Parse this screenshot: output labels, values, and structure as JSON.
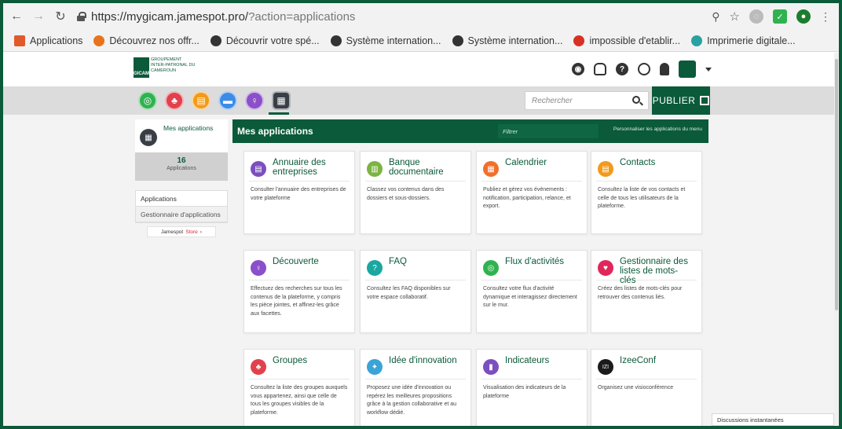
{
  "browser": {
    "url_host": "https://mygicam.jamespot.pro/",
    "url_path": "?action=applications",
    "bookmarks": [
      {
        "label": "Applications",
        "color": "#e0592a"
      },
      {
        "label": "Découvrez nos offr...",
        "color": "#e8731b"
      },
      {
        "label": "Découvrir votre spé...",
        "color": "#333333"
      },
      {
        "label": "Système internation...",
        "color": "#333333"
      },
      {
        "label": "Système internation...",
        "color": "#333333"
      },
      {
        "label": "impossible d'etablir...",
        "color": "#d93025"
      },
      {
        "label": "Imprimerie digitale...",
        "color": "#2aa1a1"
      }
    ]
  },
  "header": {
    "logo_text": "GROUPEMENT INTER-PATRONAL DU CAMEROUN",
    "logo_abbr": "GICAM",
    "icons": [
      "globe-icon",
      "bell-icon",
      "help-icon",
      "clock-icon",
      "user-icon"
    ]
  },
  "toolbar": {
    "app_dots": [
      {
        "name": "activity-app-icon",
        "color": "#2fb24f"
      },
      {
        "name": "groups-app-icon",
        "color": "#e2414c"
      },
      {
        "name": "directory-app-icon",
        "color": "#f29a1a"
      },
      {
        "name": "chat-app-icon",
        "color": "#3d8be8"
      },
      {
        "name": "discover-app-icon",
        "color": "#8a4fc9"
      },
      {
        "name": "apps-grid-icon",
        "color": "#3a3f47"
      }
    ],
    "search_placeholder": "Rechercher",
    "publish_label": "PUBLIER"
  },
  "left_panel": {
    "title": "Mes applications",
    "count": "16",
    "count_label": "Applications",
    "menu": [
      "Applications",
      "Gestionnaire d'applications"
    ],
    "store_label": "Jamespot",
    "store_highlight": "Store"
  },
  "content": {
    "title": "Mes applications",
    "filter_placeholder": "Filtrer",
    "customize_label": "Personnaliser les applications du menu",
    "cards": [
      {
        "title": "Annuaire des entreprises",
        "desc": "Consulter l'annuaire des entreprises de votre plateforme",
        "color": "#7c4fbf",
        "icon": "directory-icon",
        "glyph": "▤"
      },
      {
        "title": "Banque documentaire",
        "desc": "Classez vos contenus dans des dossiers et sous-dossiers.",
        "color": "#7cb342",
        "icon": "documents-icon",
        "glyph": "▥"
      },
      {
        "title": "Calendrier",
        "desc": "Publiez et gérez vos événements : notification, participation, relance, et export.",
        "color": "#f26f2a",
        "icon": "calendar-icon",
        "glyph": "▦"
      },
      {
        "title": "Contacts",
        "desc": "Consultez la liste de vos contacts et celle de tous les utilisateurs de la plateforme.",
        "color": "#f29a1a",
        "icon": "contacts-icon",
        "glyph": "▤"
      },
      {
        "title": "Découverte",
        "desc": "Effectuez des recherches sur tous les contenus de la plateforme, y compris les pièce jointes, et affinez-les grâce aux facettes.",
        "color": "#8a4fc9",
        "icon": "discover-icon",
        "glyph": "♀"
      },
      {
        "title": "FAQ",
        "desc": "Consultez les FAQ disponibles sur votre espace collaboratif.",
        "color": "#1aa7a0",
        "icon": "faq-icon",
        "glyph": "?"
      },
      {
        "title": "Flux d'activités",
        "desc": "Consultez votre flux d'activité dynamique et interagissez directement sur le mur.",
        "color": "#2fb24f",
        "icon": "activity-icon",
        "glyph": "◎"
      },
      {
        "title": "Gestionnaire des listes de mots-clés",
        "desc": "Créez des listes de mots-clés pour retrouver des contenus liés.",
        "color": "#e0265b",
        "icon": "keywords-icon",
        "glyph": "♥"
      },
      {
        "title": "Groupes",
        "desc": "Consultez la liste des groupes auxquels vous appartenez, ainsi que celle de tous les groupes visibles de la plateforme.",
        "color": "#e2414c",
        "icon": "groups-icon",
        "glyph": "♣"
      },
      {
        "title": "Idée d'innovation",
        "desc": "Proposez une idée d'innovation ou repérez les meilleures propositions grâce à la gestion collaborative et au workflow dédié.",
        "color": "#3aa3d8",
        "icon": "idea-icon",
        "glyph": "✦"
      },
      {
        "title": "Indicateurs",
        "desc": "Visualisation des indicateurs de la plateforme",
        "color": "#7c4fbf",
        "icon": "indicators-icon",
        "glyph": "▮"
      },
      {
        "title": "IzeeConf",
        "desc": "Organisez une visioconférence",
        "color": "#1b1b1b",
        "icon": "izeeconf-icon",
        "glyph": "IZI"
      }
    ]
  },
  "chat": {
    "label": "Discussions instantanées"
  }
}
